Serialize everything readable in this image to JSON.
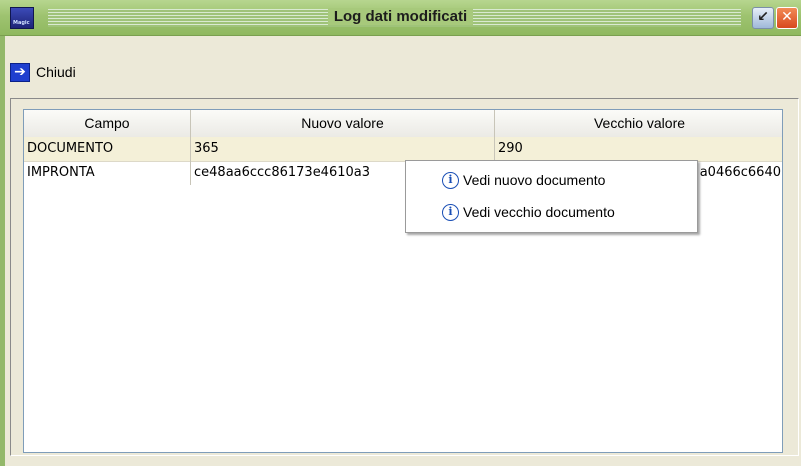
{
  "window": {
    "title": "Log dati modificati",
    "app_icon_text": "Magic"
  },
  "toolbar": {
    "close_label": "Chiudi"
  },
  "grid": {
    "columns": [
      "Campo",
      "Nuovo valore",
      "Vecchio valore"
    ],
    "rows": [
      {
        "campo": "DOCUMENTO",
        "nuovo": "365",
        "vecchio": "290"
      },
      {
        "campo": "IMPRONTA",
        "nuovo": "ce48aa6ccc86173e4610a3",
        "vecchio": "a0466c6640"
      }
    ]
  },
  "context_menu": {
    "items": [
      {
        "label": "Vedi nuovo documento",
        "icon": "info-icon"
      },
      {
        "label": "Vedi vecchio documento",
        "icon": "info-icon"
      }
    ]
  }
}
